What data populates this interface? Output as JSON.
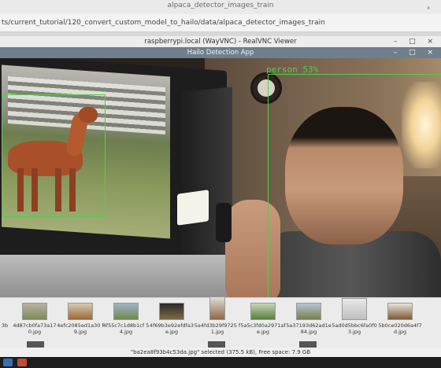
{
  "outer_window": {
    "title": "alpaca_detector_images_train"
  },
  "path_bar": {
    "path": "ts/current_tutorial/120_convert_custom_model_to_hailo/data/alpaca_detector_images_train"
  },
  "vnc_window": {
    "title": "raspberrypi.local (WayVNC) - RealVNC Viewer",
    "controls": "– □ ×"
  },
  "app_window": {
    "title": "Hailo Detection App",
    "controls": "– □ ×"
  },
  "detections": [
    {
      "label": "person 53%",
      "color": "#4fcf4f"
    },
    {
      "label": "alpaca",
      "color": "#4fcf4f"
    }
  ],
  "thumbnails": [
    {
      "caption": "3b"
    },
    {
      "caption": "4d87cb0fa73a17 0.jpg"
    },
    {
      "caption": "4efc2085ed1a30 f9.jpg"
    },
    {
      "caption": "4f55c7c1d8b1cf 54.jpg"
    },
    {
      "caption": "4f69b3e92efdfa3 e.jpg"
    },
    {
      "caption": "5a4fd3b29f9725 f1.jpg"
    },
    {
      "caption": "5a5c3fd0a2971af e.jpg"
    },
    {
      "caption": "5a37193d62ad1e 84.jpg"
    },
    {
      "caption": "5ad0d5bbc6fa0f0 3.jpg"
    },
    {
      "caption": "5b0ce020d6a4f7 d.jpg"
    }
  ],
  "status": {
    "text": "\"ba2ea8f93b4c53da.jpg\" selected (375.5 kB), Free space: 7.9 GB"
  }
}
